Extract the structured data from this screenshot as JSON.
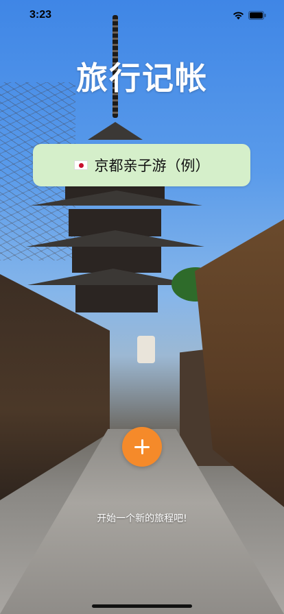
{
  "status_bar": {
    "time": "3:23",
    "icons": [
      "wifi-icon",
      "battery-icon"
    ]
  },
  "app": {
    "title": "旅行记帐"
  },
  "trip_card": {
    "flag_icon": "japan-flag-icon",
    "name": "京都亲子游（例）",
    "background": "#d5efca"
  },
  "add_button": {
    "icon": "plus-icon",
    "color": "#f58a2a"
  },
  "prompt": {
    "text": "开始一个新的旅程吧!"
  }
}
